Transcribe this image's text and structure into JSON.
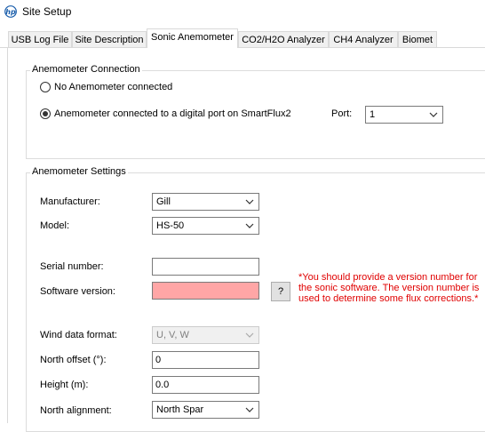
{
  "window": {
    "title": "Site Setup",
    "logo_icon": "hp-logo-icon"
  },
  "tabs": [
    {
      "label": "USB Log File",
      "active": false
    },
    {
      "label": "Site Description",
      "active": false
    },
    {
      "label": "Sonic Anemometer",
      "active": true
    },
    {
      "label": "CO2/H2O Analyzer",
      "active": false
    },
    {
      "label": "CH4 Analyzer",
      "active": false
    },
    {
      "label": "Biomet",
      "active": false
    }
  ],
  "connection": {
    "group_title": "Anemometer Connection",
    "option_none": "No Anemometer connected",
    "option_digital": "Anemometer connected to a digital port on SmartFlux2",
    "selected": "option_digital",
    "port_label": "Port:",
    "port_value": "1"
  },
  "settings": {
    "group_title": "Anemometer Settings",
    "manufacturer_label": "Manufacturer:",
    "manufacturer_value": "Gill",
    "model_label": "Model:",
    "model_value": "HS-50",
    "serial_label": "Serial number:",
    "serial_value": "",
    "software_label": "Software version:",
    "software_value": "",
    "help_button": "?",
    "warning": "*You should provide a version number for the sonic software.  The version number is used to determine some flux corrections.*",
    "wind_format_label": "Wind data format:",
    "wind_format_value": "U, V, W",
    "north_offset_label": "North offset (°):",
    "north_offset_value": "0",
    "height_label": "Height (m):",
    "height_value": "0.0",
    "north_alignment_label": "North alignment:",
    "north_alignment_value": "North Spar"
  },
  "colors": {
    "error_field": "#ffa6a6",
    "warning_text": "#e00000"
  }
}
